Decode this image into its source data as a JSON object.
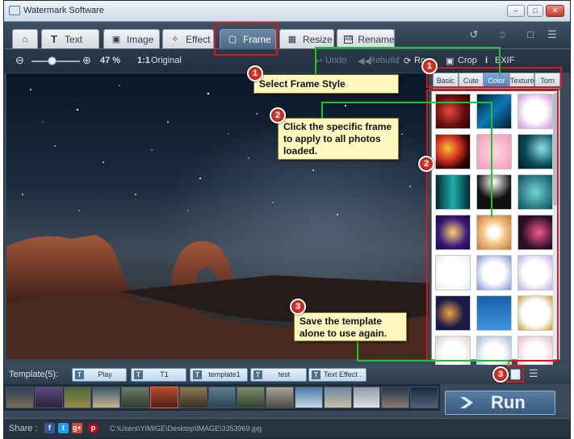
{
  "window": {
    "title": "Watermark Software"
  },
  "tabs": [
    {
      "label": "",
      "icon": "home-icon"
    },
    {
      "label": "Text",
      "icon": "text-icon"
    },
    {
      "label": "Image",
      "icon": "image-icon"
    },
    {
      "label": "Effect",
      "icon": "magic-wand-icon"
    },
    {
      "label": "Frame",
      "icon": "frame-icon",
      "active": true
    },
    {
      "label": "Resize",
      "icon": "resize-icon"
    },
    {
      "label": "Rename",
      "icon": "rename-icon"
    }
  ],
  "subtoolbar": {
    "zoom_percent": "47 %",
    "original_label": "Original",
    "undo_label": "Undo",
    "rebuild_label": "Rebuild",
    "rotate_label": "Ro",
    "crop_label": "Crop",
    "exif_label": "EXIF"
  },
  "frame_styles": [
    "Basic",
    "Cute",
    "Color",
    "Texture",
    "Torn"
  ],
  "active_frame_style": "Color",
  "template_bar": {
    "label": "Template(5):",
    "templates": [
      "Play",
      "T1",
      "template1",
      "test",
      "Text Effect ..."
    ]
  },
  "run_label": "Run",
  "statusbar": {
    "share_label": "Share :",
    "path": "C:\\Users\\YIMIGE\\Desktop\\IMAGE\\3353969.jpg"
  },
  "callouts": {
    "select_style": {
      "number": "1",
      "text": "Select Frame Style"
    },
    "click_frame": {
      "number": "2",
      "text": "Click the specific frame to apply to all photos loaded."
    },
    "save_template": {
      "number": "3",
      "text": "Save the template alone to use again."
    }
  },
  "colors": {
    "highlight": "#d41a1a",
    "connector": "#22c22e",
    "callout_bg": "#fff8bf"
  }
}
